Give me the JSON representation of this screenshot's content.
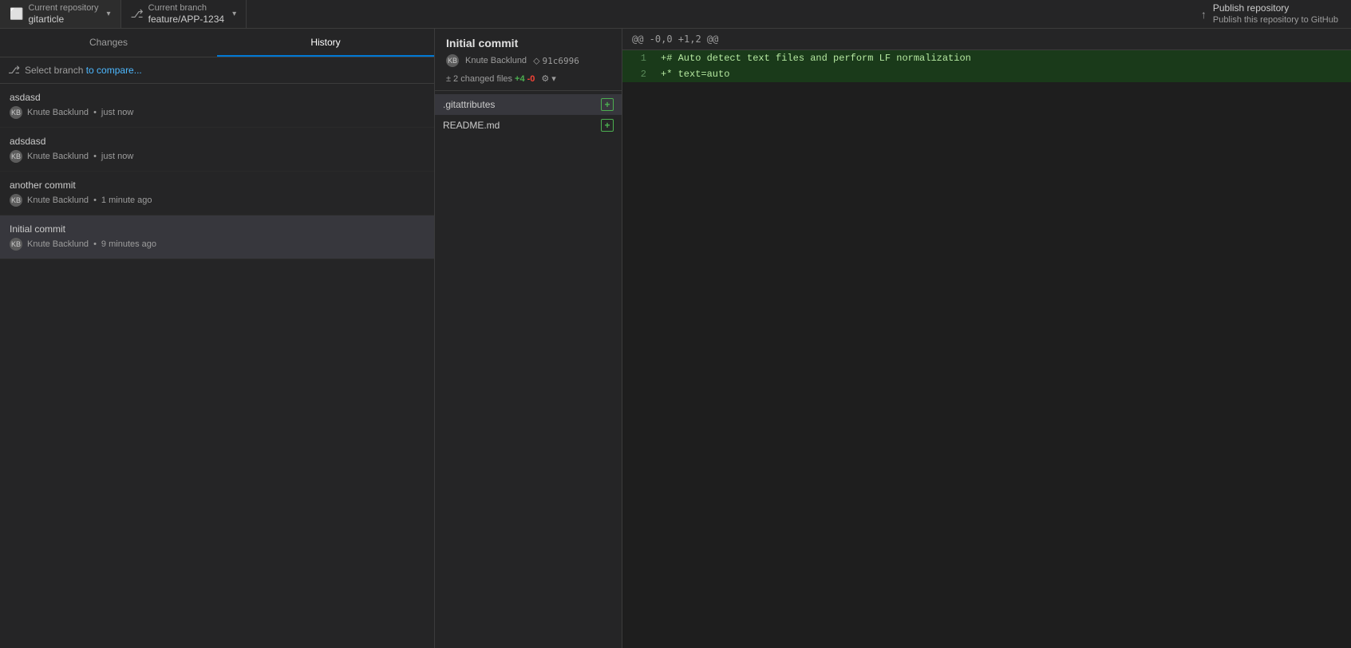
{
  "topbar": {
    "repo_label": "Current repository",
    "repo_name": "gitarticle",
    "branch_label": "Current branch",
    "branch_name": "feature/APP-1234",
    "publish_title": "Publish repository",
    "publish_subtitle": "Publish this repository to GitHub"
  },
  "tabs": {
    "changes_label": "Changes",
    "history_label": "History"
  },
  "select_branch": {
    "icon": "⎇",
    "text_start": "Select branch",
    "text_highlight": "to compare...",
    "full_text": "Select branch to compare..."
  },
  "commits": [
    {
      "id": 1,
      "title": "asdasd",
      "author": "Knute Backlund",
      "time": "just now",
      "selected": false
    },
    {
      "id": 2,
      "title": "adsdasd",
      "author": "Knute Backlund",
      "time": "just now",
      "selected": false
    },
    {
      "id": 3,
      "title": "another commit",
      "author": "Knute Backlund",
      "time": "1 minute ago",
      "selected": false
    },
    {
      "id": 4,
      "title": "Initial commit",
      "author": "Knute Backlund",
      "time": "9 minutes ago",
      "selected": true
    }
  ],
  "commit_detail": {
    "title": "Initial commit",
    "author_avatar": "KB",
    "author": "Knute Backlund",
    "hash": "91c6996",
    "changed_files_count": "2 changed files",
    "additions": "+4",
    "deletions": "-0"
  },
  "files": [
    {
      "name": ".gitattributes",
      "selected": true,
      "status": "added"
    },
    {
      "name": "README.md",
      "selected": false,
      "status": "added"
    }
  ],
  "diff": {
    "header": "@@ -0,0 +1,2 @@",
    "lines": [
      {
        "number": "1",
        "type": "added",
        "content": "+# Auto detect text files and perform LF normalization"
      },
      {
        "number": "2",
        "type": "added",
        "content": "+* text=auto"
      }
    ]
  }
}
